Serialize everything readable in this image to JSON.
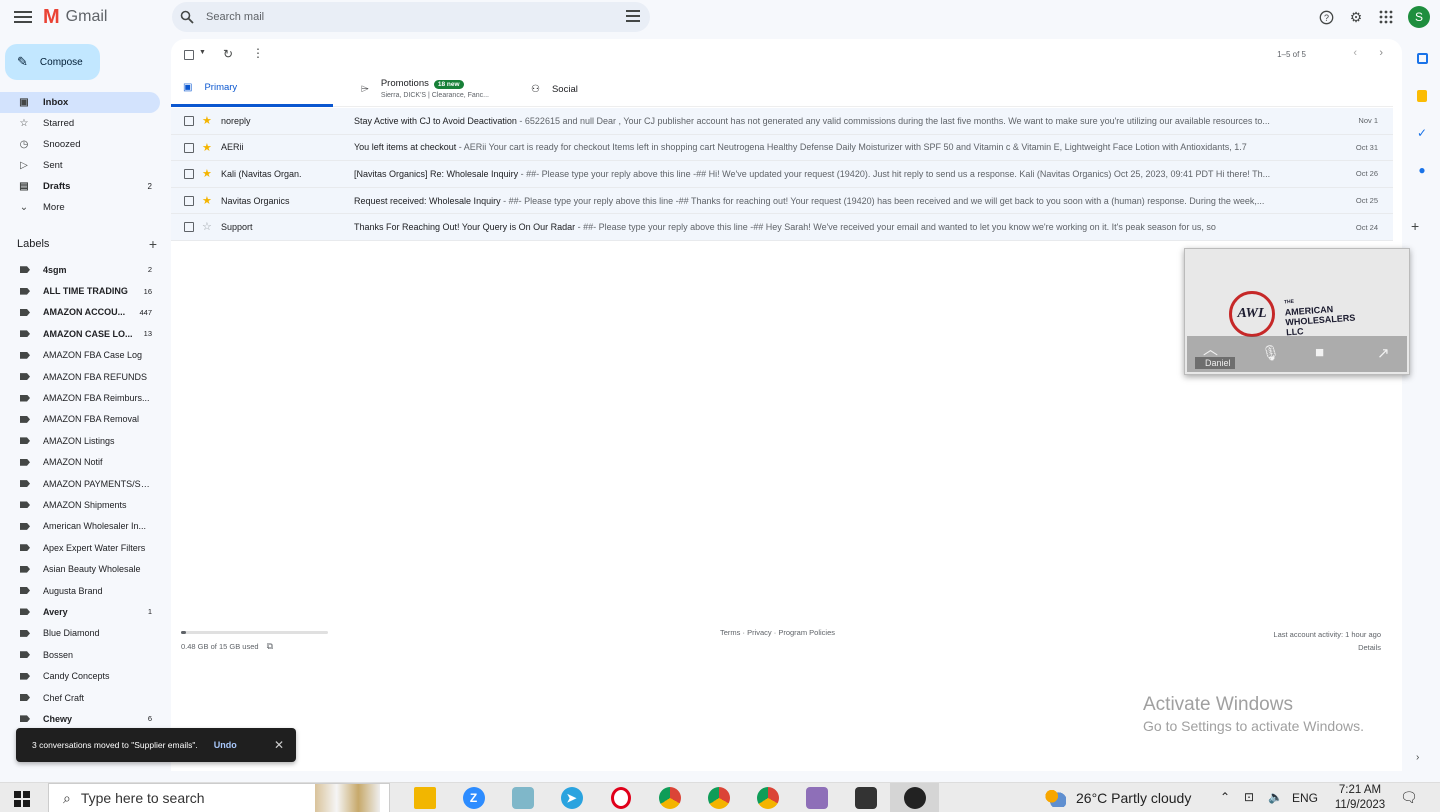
{
  "app": {
    "name": "Gmail",
    "avatar_initial": "S"
  },
  "search": {
    "placeholder": "Search mail"
  },
  "compose": {
    "label": "Compose"
  },
  "nav": [
    {
      "label": "Inbox",
      "icon": "inbox-icon",
      "glyph": "▣",
      "count": "",
      "active": true,
      "bold": true
    },
    {
      "label": "Starred",
      "icon": "star-icon",
      "glyph": "☆",
      "count": "",
      "active": false,
      "bold": false
    },
    {
      "label": "Snoozed",
      "icon": "clock-icon",
      "glyph": "◷",
      "count": "",
      "active": false,
      "bold": false
    },
    {
      "label": "Sent",
      "icon": "send-icon",
      "glyph": "▷",
      "count": "",
      "active": false,
      "bold": false
    },
    {
      "label": "Drafts",
      "icon": "draft-icon",
      "glyph": "▤",
      "count": "2",
      "active": false,
      "bold": true
    },
    {
      "label": "More",
      "icon": "chevron-down-icon",
      "glyph": "⌄",
      "count": "",
      "active": false,
      "bold": false
    }
  ],
  "labels_header": "Labels",
  "labels": [
    {
      "name": "4sgm",
      "count": "2",
      "bold": true
    },
    {
      "name": "ALL TIME TRADING",
      "count": "16",
      "bold": true
    },
    {
      "name": "AMAZON ACCOU...",
      "count": "447",
      "bold": true
    },
    {
      "name": "AMAZON CASE LO...",
      "count": "13",
      "bold": true
    },
    {
      "name": "AMAZON FBA Case Log",
      "count": "",
      "bold": false
    },
    {
      "name": "AMAZON FBA REFUNDS",
      "count": "",
      "bold": false
    },
    {
      "name": "AMAZON FBA Reimburs...",
      "count": "",
      "bold": false
    },
    {
      "name": "AMAZON FBA Removal",
      "count": "",
      "bold": false
    },
    {
      "name": "AMAZON Listings",
      "count": "",
      "bold": false
    },
    {
      "name": "AMAZON Notif",
      "count": "",
      "bold": false
    },
    {
      "name": "AMAZON PAYMENTS/SE...",
      "count": "",
      "bold": false
    },
    {
      "name": "AMAZON Shipments",
      "count": "",
      "bold": false
    },
    {
      "name": "American Wholesaler In...",
      "count": "",
      "bold": false
    },
    {
      "name": "Apex Expert Water Filters",
      "count": "",
      "bold": false
    },
    {
      "name": "Asian Beauty Wholesale",
      "count": "",
      "bold": false
    },
    {
      "name": "Augusta Brand",
      "count": "",
      "bold": false
    },
    {
      "name": "Avery",
      "count": "1",
      "bold": true
    },
    {
      "name": "Blue Diamond",
      "count": "",
      "bold": false
    },
    {
      "name": "Bossen",
      "count": "",
      "bold": false
    },
    {
      "name": "Candy Concepts",
      "count": "",
      "bold": false
    },
    {
      "name": "Chef Craft",
      "count": "",
      "bold": false
    },
    {
      "name": "Chewy",
      "count": "6",
      "bold": true
    }
  ],
  "pager": {
    "text": "1–5 of 5"
  },
  "tabs": {
    "primary": "Primary",
    "promotions": "Promotions",
    "promotions_badge": "18 new",
    "promotions_sub": "Sierra, DICK'S | Clearance, Fanc...",
    "social": "Social"
  },
  "emails": [
    {
      "sender": "noreply",
      "subject": "Stay Active with CJ to Avoid Deactivation",
      "snippet": " - 6522615 and null Dear , Your CJ publisher account has not generated any valid commissions during the last five months. We want to make sure you're utilizing our available resources to...",
      "date": "Nov 1",
      "starred": true
    },
    {
      "sender": "AERii",
      "subject": "You left items at checkout",
      "snippet": " - AERii Your cart is ready for checkout Items left in shopping cart Neutrogena Healthy Defense Daily Moisturizer with SPF 50 and Vitamin c & Vitamin E, Lightweight Face Lotion with Antioxidants, 1.7",
      "date": "Oct 31",
      "starred": true
    },
    {
      "sender": "Kali (Navitas Organ.",
      "subject": "[Navitas Organics] Re: Wholesale Inquiry",
      "snippet": " - ##- Please type your reply above this line -## Hi! We've updated your request (19420). Just hit reply to send us a response. Kali (Navitas Organics) Oct 25, 2023, 09:41 PDT Hi there! Th...",
      "date": "Oct 26",
      "starred": true
    },
    {
      "sender": "Navitas Organics",
      "subject": "Request received: Wholesale Inquiry",
      "snippet": " - ##- Please type your reply above this line -## Thanks for reaching out! Your request (19420) has been received and we will get back to you soon with a (human) response. During the week,...",
      "date": "Oct 25",
      "starred": true
    },
    {
      "sender": "Support",
      "subject": "Thanks For Reaching Out! Your Query is On Our Radar",
      "snippet": " - ##- Please type your reply above this line -## Hey Sarah! We've received your email and wanted to let you know we're working on it. It's peak season for us, so",
      "date": "Oct 24",
      "starred": false
    }
  ],
  "footer": {
    "storage": "0.48 GB of 15 GB used",
    "storage_fraction": 0.032,
    "links": "Terms · Privacy · Program Policies",
    "activity": "Last account activity: 1 hour ago",
    "details": "Details"
  },
  "video": {
    "name": "Daniel",
    "logo_letters": "AWL",
    "logo_text_1": "AMERICAN",
    "logo_text_2": "WHOLESALERS",
    "logo_text_3": "LLC",
    "logo_small": "THE"
  },
  "toast": {
    "message": "3 conversations moved to \"Supplier emails\".",
    "undo": "Undo"
  },
  "watermark": {
    "line1": "Activate Windows",
    "line2": "Go to Settings to activate Windows."
  },
  "taskbar": {
    "search_placeholder": "Type here to search",
    "weather": "26°C  Partly cloudy",
    "lang": "ENG",
    "time": "7:21 AM",
    "date": "11/9/2023"
  },
  "colors": {
    "accent": "#0b57d0",
    "compose": "#c2e7ff",
    "star": "#f4b400"
  }
}
